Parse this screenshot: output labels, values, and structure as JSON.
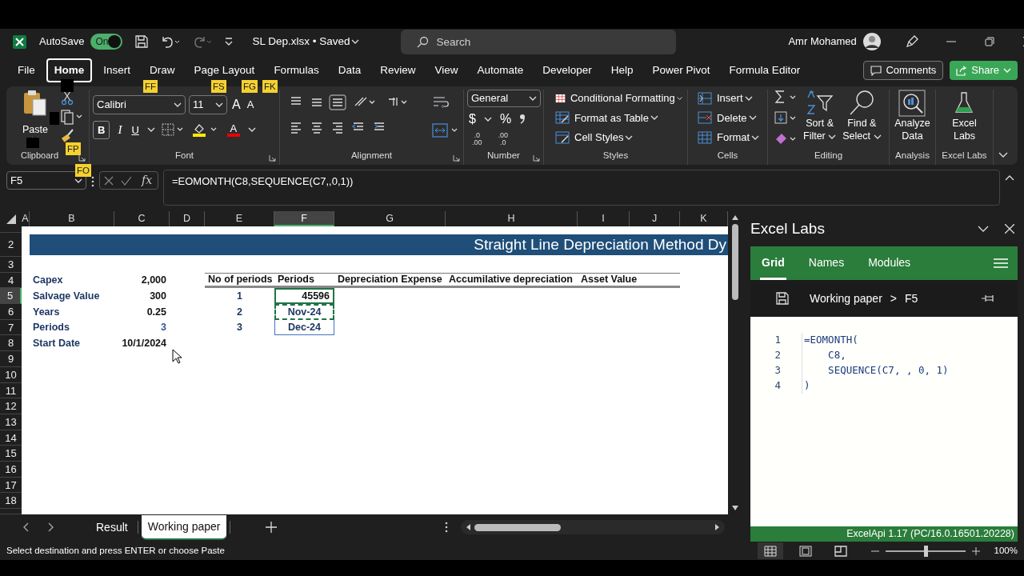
{
  "title_bar": {
    "autosave_label": "AutoSave",
    "autosave_on": true,
    "autosave_state": "On",
    "document": "SL Dep.xlsx • Saved",
    "search_placeholder": "Search",
    "user": "Amr Mohamed"
  },
  "ribbon_tabs": [
    {
      "label": "File",
      "selected": false
    },
    {
      "label": "Home",
      "selected": true
    },
    {
      "label": "Insert",
      "selected": false
    },
    {
      "label": "Draw",
      "selected": false
    },
    {
      "label": "Page Layout",
      "selected": false
    },
    {
      "label": "Formulas",
      "selected": false
    },
    {
      "label": "Data",
      "selected": false
    },
    {
      "label": "Review",
      "selected": false
    },
    {
      "label": "View",
      "selected": false
    },
    {
      "label": "Automate",
      "selected": false
    },
    {
      "label": "Developer",
      "selected": false
    },
    {
      "label": "Help",
      "selected": false
    },
    {
      "label": "Power Pivot",
      "selected": false
    },
    {
      "label": "Formula Editor",
      "selected": false
    }
  ],
  "comments_button": "Comments",
  "share_button": "Share",
  "ribbon": {
    "clipboard": {
      "paste": "Paste",
      "group": "Clipboard"
    },
    "font": {
      "font_name": "Calibri",
      "font_size": "11",
      "grow": "A",
      "shrink": "A",
      "bold": "B",
      "italic": "I",
      "underline": "U",
      "font_color": "A",
      "group": "Font"
    },
    "alignment": {
      "group": "Alignment"
    },
    "number": {
      "format": "General",
      "currency": "$",
      "percent": "%",
      "decimals": [
        {
          "top": ".0",
          "bottom": ".00"
        },
        {
          "top": ".00",
          "bottom": ".0"
        }
      ],
      "group": "Number"
    },
    "styles": {
      "items": [
        "Conditional Formatting",
        "Format as Table",
        "Cell Styles"
      ],
      "group": "Styles"
    },
    "cells": {
      "items": [
        "Insert",
        "Delete",
        "Format"
      ],
      "group": "Cells"
    },
    "editing": {
      "sort": [
        "Sort &",
        "Filter"
      ],
      "find": [
        "Find &",
        "Select"
      ],
      "group": "Editing"
    },
    "analysis": {
      "label": [
        "Analyze",
        "Data"
      ],
      "group": "Analysis"
    },
    "excel_labs": {
      "label": [
        "Excel",
        "Labs"
      ],
      "group": "Excel Labs"
    }
  },
  "keytips": [
    "FF",
    "FS",
    "FG",
    "FK",
    "FP",
    "FO"
  ],
  "formula_bar": {
    "name_box": "F5",
    "fx": "fx",
    "formula": "=EOMONTH(C8,SEQUENCE(C7,,0,1))"
  },
  "sheet": {
    "columns": [
      {
        "label": "A",
        "selected": false
      },
      {
        "label": "B",
        "selected": false
      },
      {
        "label": "C",
        "selected": false
      },
      {
        "label": "D",
        "selected": false
      },
      {
        "label": "E",
        "selected": false
      },
      {
        "label": "F",
        "selected": true
      },
      {
        "label": "G",
        "selected": false
      },
      {
        "label": "H",
        "selected": false
      },
      {
        "label": "I",
        "selected": false
      },
      {
        "label": "J",
        "selected": false
      },
      {
        "label": "K",
        "selected": false
      }
    ],
    "title": "Straight Line Depreciation Method Dy",
    "rows": [
      {
        "label": "2",
        "selected": false
      },
      {
        "label": "3",
        "selected": false
      },
      {
        "label": "4",
        "selected": false,
        "cells": {
          "B": {
            "text": "Capex",
            "kind": "label"
          },
          "C": {
            "text": "2,000",
            "kind": "value"
          },
          "E": {
            "text": "No of periods",
            "kind": "header"
          },
          "F": {
            "text": "Periods",
            "kind": "header"
          },
          "G": {
            "text": "Depreciation Expense",
            "kind": "header"
          },
          "H": {
            "text": "Accumilative depreciation",
            "kind": "header"
          },
          "I": {
            "text": "Asset Value",
            "kind": "header"
          }
        }
      },
      {
        "label": "5",
        "selected": true,
        "cells": {
          "B": {
            "text": "Salvage Value",
            "kind": "label"
          },
          "C": {
            "text": "300",
            "kind": "value"
          },
          "E": {
            "text": "1",
            "kind": "center"
          },
          "F": {
            "text": "45596",
            "kind": "value",
            "active": true
          }
        }
      },
      {
        "label": "6",
        "selected": false,
        "cells": {
          "B": {
            "text": "Years",
            "kind": "label"
          },
          "C": {
            "text": "0.25",
            "kind": "value"
          },
          "E": {
            "text": "2",
            "kind": "center"
          },
          "F": {
            "text": "Nov-24",
            "kind": "center",
            "marquee": true
          }
        }
      },
      {
        "label": "7",
        "selected": false,
        "cells": {
          "B": {
            "text": "Periods",
            "kind": "label"
          },
          "C": {
            "text": "3",
            "kind": "input"
          },
          "E": {
            "text": "3",
            "kind": "center"
          },
          "F": {
            "text": "Dec-24",
            "kind": "center",
            "spill": true
          }
        }
      },
      {
        "label": "8",
        "selected": false,
        "cells": {
          "B": {
            "text": "Start Date",
            "kind": "label"
          },
          "C": {
            "text": "10/1/2024",
            "kind": "value"
          }
        }
      },
      {
        "label": "9",
        "selected": false
      },
      {
        "label": "10",
        "selected": false
      },
      {
        "label": "11",
        "selected": false
      },
      {
        "label": "12",
        "selected": false
      },
      {
        "label": "13",
        "selected": false
      },
      {
        "label": "14",
        "selected": false
      },
      {
        "label": "15",
        "selected": false
      },
      {
        "label": "16",
        "selected": false
      },
      {
        "label": "17",
        "selected": false
      },
      {
        "label": "18",
        "selected": false
      }
    ]
  },
  "sheet_tabs": [
    {
      "label": "Result",
      "selected": false
    },
    {
      "label": "Working paper",
      "selected": true
    }
  ],
  "panel": {
    "title": "Excel Labs",
    "tabs": [
      {
        "label": "Grid",
        "selected": true
      },
      {
        "label": "Names",
        "selected": false
      },
      {
        "label": "Modules",
        "selected": false
      }
    ],
    "breadcrumb": {
      "sheet": "Working paper",
      "separator": ">",
      "cell": "F5"
    },
    "code": [
      {
        "number": "1",
        "text": "=EOMONTH("
      },
      {
        "number": "2",
        "text": "    C8,"
      },
      {
        "number": "3",
        "text": "    SEQUENCE(C7, , 0, 1)"
      },
      {
        "number": "4",
        "text": ")"
      }
    ],
    "footer": "ExcelApi 1.17 (PC/16.0.16501.20228)"
  },
  "status_bar": {
    "message": "Select destination and press ENTER or choose Paste",
    "views": [
      {
        "selected": true
      },
      {
        "selected": false
      },
      {
        "selected": false
      }
    ],
    "zoom": {
      "level": 0.5,
      "reading": "100%"
    }
  }
}
